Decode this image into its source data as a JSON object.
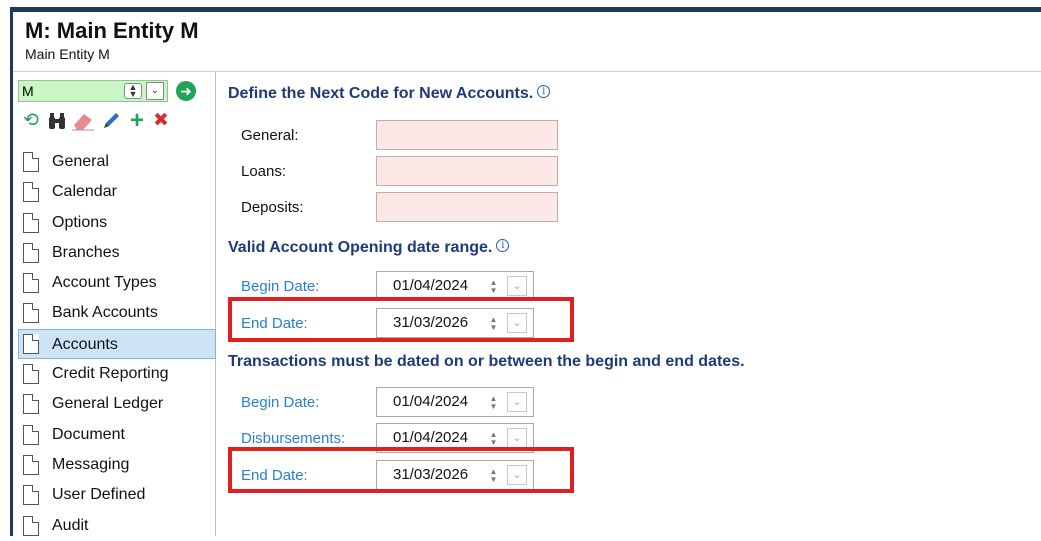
{
  "header": {
    "title": "M: Main Entity M",
    "subtitle": "Main Entity M"
  },
  "sidebar": {
    "entity_input_value": "M",
    "toolbar_icons": [
      "history-icon",
      "binoculars-icon",
      "eraser-icon",
      "pencil-icon",
      "add-icon",
      "delete-icon"
    ],
    "items": [
      {
        "label": "General"
      },
      {
        "label": "Calendar"
      },
      {
        "label": "Options"
      },
      {
        "label": "Branches"
      },
      {
        "label": "Account Types"
      },
      {
        "label": "Bank Accounts"
      },
      {
        "label": "Accounts",
        "selected": true
      },
      {
        "label": "Credit Reporting"
      },
      {
        "label": "General Ledger"
      },
      {
        "label": "Document"
      },
      {
        "label": "Messaging"
      },
      {
        "label": "User Defined"
      },
      {
        "label": "Audit"
      }
    ]
  },
  "next_code": {
    "title": "Define the Next Code for New Accounts.",
    "general_label": "General:",
    "general_value": "",
    "loans_label": "Loans:",
    "loans_value": "",
    "deposits_label": "Deposits:",
    "deposits_value": ""
  },
  "opening_range": {
    "title": "Valid Account Opening date range.",
    "begin_label": "Begin Date:",
    "begin_value": "01/04/2024",
    "end_label": "End Date:",
    "end_value": "31/03/2026"
  },
  "transactions": {
    "title": "Transactions must be dated on or between the begin and end dates.",
    "begin_label": "Begin Date:",
    "begin_value": "01/04/2024",
    "disb_label": "Disbursements:",
    "disb_value": "01/04/2024",
    "end_label": "End Date:",
    "end_value": "31/03/2026"
  },
  "colors": {
    "header_border": "#1e3a5f",
    "section_title": "#1e3a78",
    "date_label": "#2a7fd4",
    "highlight": "#e02020",
    "code_input_bg": "#fde8e8",
    "entity_input_bg": "#c8f7c5"
  }
}
